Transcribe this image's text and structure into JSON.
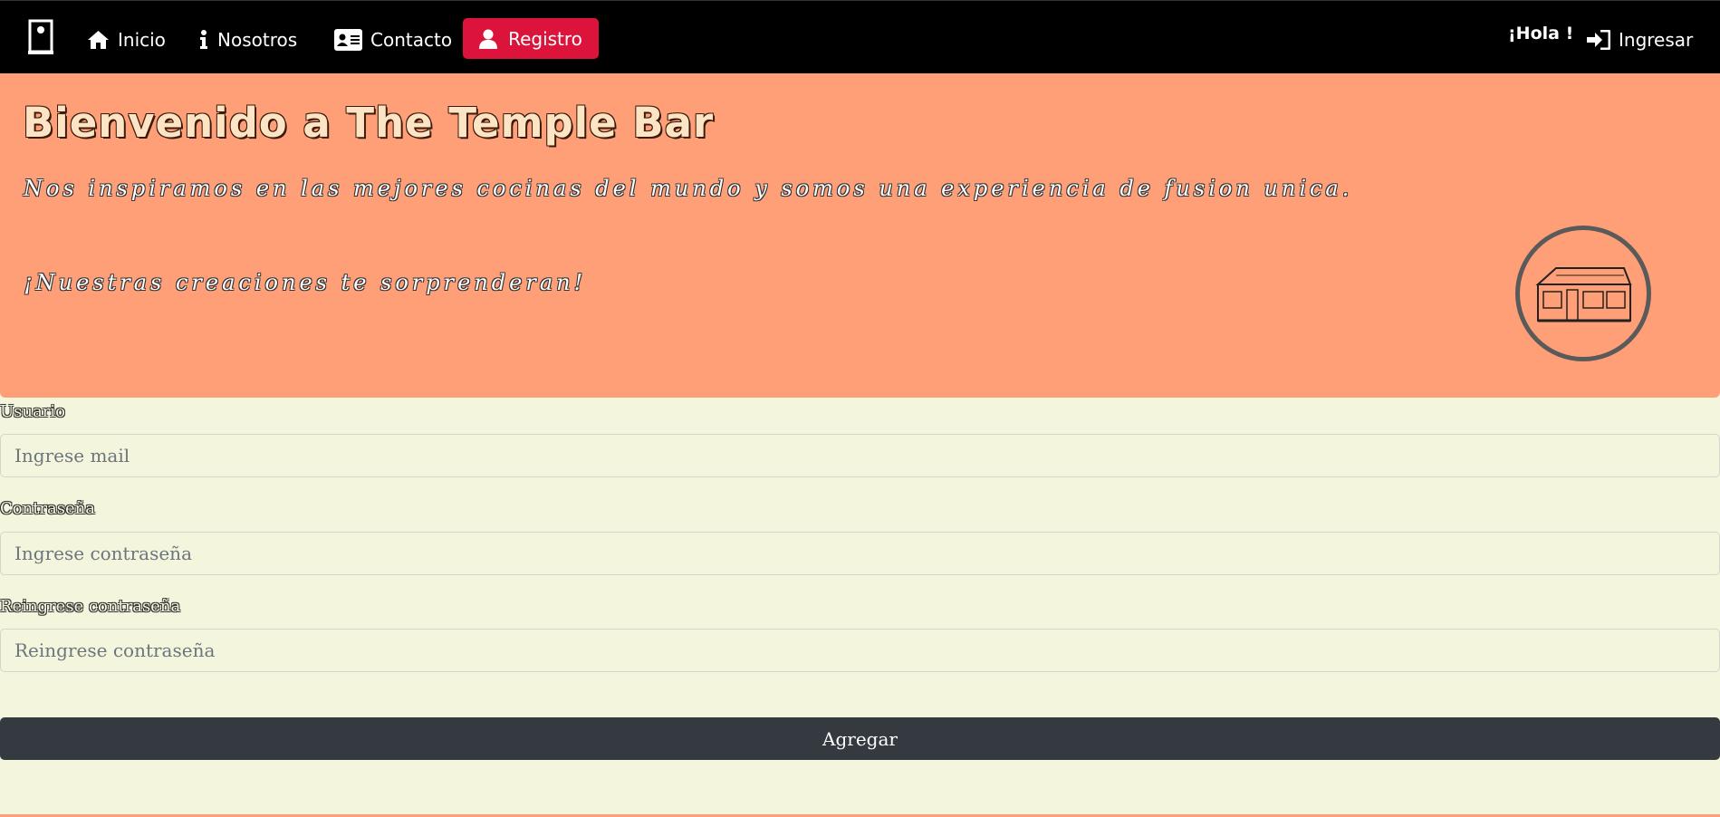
{
  "navbar": {
    "brand_icon": "door-icon",
    "items": [
      {
        "label": "Inicio",
        "icon": "home-icon"
      },
      {
        "label": "Nosotros",
        "icon": "info-icon"
      },
      {
        "label": "Contacto",
        "icon": "address-card-icon"
      },
      {
        "label": "Registro",
        "icon": "user-icon",
        "active": true
      }
    ],
    "greeting": "¡Hola !",
    "login_label": "Ingresar",
    "login_icon": "sign-in-icon",
    "active_color": "#dc143c"
  },
  "hero": {
    "title": "Bienvenido a The Temple Bar",
    "line1": "Nos inspiramos en las mejores cocinas del mundo y somos una experiencia de fusion unica.",
    "line2": "¡Nuestras creaciones te sorprenderan!",
    "logo_icon": "storefront-logo-icon",
    "background_color": "#ff9f78"
  },
  "form": {
    "user_label": "Usuario",
    "user_placeholder": "Ingrese mail",
    "password_label": "Contraseña",
    "password_placeholder": "Ingrese contraseña",
    "repassword_label": "Reingrese contraseña",
    "repassword_placeholder": "Reingrese contraseña",
    "submit_label": "Agregar",
    "background_color": "#f4f5dd",
    "button_color": "#343a40"
  }
}
